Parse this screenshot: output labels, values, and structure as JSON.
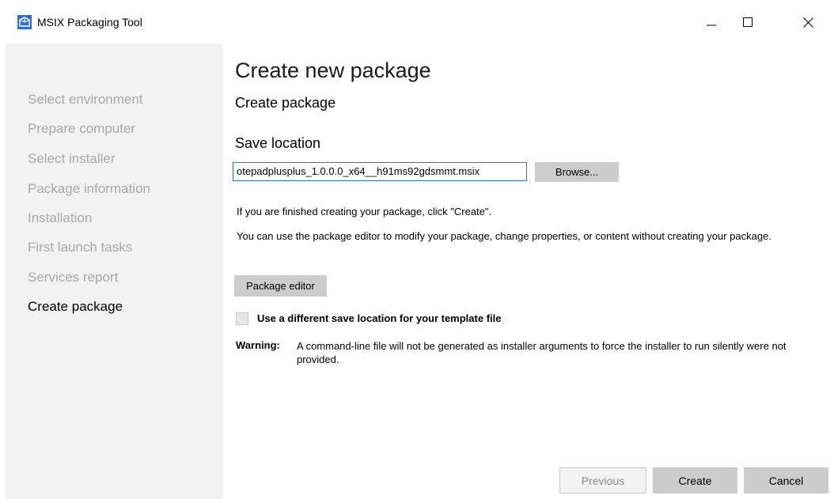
{
  "window": {
    "title": "MSIX Packaging Tool",
    "controls": [
      "minimize-icon",
      "maximize-icon",
      "close-icon"
    ]
  },
  "sidebar": {
    "items": [
      {
        "label": "Select environment",
        "active": false
      },
      {
        "label": "Prepare computer",
        "active": false
      },
      {
        "label": "Select installer",
        "active": false
      },
      {
        "label": "Package information",
        "active": false
      },
      {
        "label": "Installation",
        "active": false
      },
      {
        "label": "First launch tasks",
        "active": false
      },
      {
        "label": "Services report",
        "active": false
      },
      {
        "label": "Create package",
        "active": true
      }
    ]
  },
  "main": {
    "page_title": "Create new package",
    "section_title": "Create package",
    "save_location_label": "Save location",
    "save_location_value": "otepadplusplus_1.0.0.0_x64__h91ms92gdsmmt.msix",
    "browse_label": "Browse...",
    "info_create": "If you are finished creating your package, click \"Create\".",
    "info_editor": "You can use the package editor to modify your package, change properties, or content without creating your package.",
    "package_editor_label": "Package editor",
    "template_checkbox_label": "Use a different save location for your template file",
    "template_checkbox_checked": false,
    "warning_label": "Warning:",
    "warning_text": "A command-line file will not be generated as installer arguments to force the installer to run silently were not provided."
  },
  "footer": {
    "previous_label": "Previous",
    "create_label": "Create",
    "cancel_label": "Cancel"
  },
  "colors": {
    "sidebar_bg": "#f2f2f2",
    "inactive_nav": "#a8a8a8",
    "button_bg": "#cccccc",
    "input_border": "#2b6fd6",
    "app_icon": "#2b6fd6"
  }
}
